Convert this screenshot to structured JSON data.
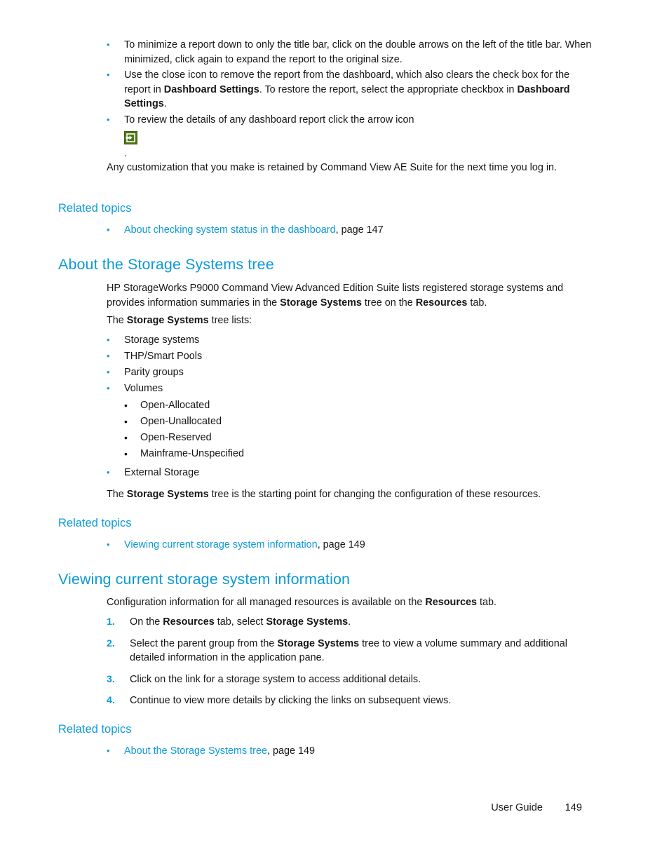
{
  "colors": {
    "heading_blue": "#0c9ad8",
    "link_blue": "#0c9ad8",
    "body_text": "#161616",
    "icon_green": "#4e7615",
    "page_background": "#ffffff"
  },
  "top_bullets": [
    {
      "bullet": "•",
      "text": "To minimize a report down to only the title bar, click on the double arrows on the left of the title bar. When minimized, click again to expand the report to the original size."
    },
    {
      "bullet": "•",
      "text_part_1": "Use the close icon to remove the report from the dashboard, which also clears the check box for the report in ",
      "bold_1": "Dashboard Settings",
      "text_part_2": ". To restore the report, select the appropriate checkbox in ",
      "bold_2": "Dashboard Settings",
      "text_part_3": "."
    },
    {
      "bullet": "•",
      "text": "To review the details of any dashboard report click the arrow icon",
      "icon_name": "open-details-arrow-icon",
      "trailing_period": "."
    }
  ],
  "customization_note": "Any customization that you make is retained by Command View AE Suite for the next time you log in.",
  "related_topics_1": {
    "heading": "Related topics",
    "items": [
      {
        "bullet": "•",
        "link": "About checking system status in the dashboard",
        "suffix": ", page 147"
      }
    ]
  },
  "section_storage_tree": {
    "heading": "About the Storage Systems tree",
    "intro_part_1": "HP StorageWorks P9000 Command View Advanced Edition Suite lists registered storage systems and provides information summaries in the ",
    "intro_bold_1": "Storage Systems",
    "intro_part_2": " tree on the ",
    "intro_bold_2": "Resources",
    "intro_part_3": " tab.",
    "lists_lead_part_1": "The ",
    "lists_lead_bold": "Storage Systems",
    "lists_lead_part_2": " tree lists:",
    "tree_items": [
      {
        "bullet": "•",
        "label": "Storage systems"
      },
      {
        "bullet": "•",
        "label": "THP/Smart Pools"
      },
      {
        "bullet": "•",
        "label": "Parity groups"
      },
      {
        "bullet": "•",
        "label": "Volumes"
      }
    ],
    "volume_sub_items": [
      {
        "bullet": "•",
        "label": "Open-Allocated"
      },
      {
        "bullet": "•",
        "label": "Open-Unallocated"
      },
      {
        "bullet": "•",
        "label": "Open-Reserved"
      },
      {
        "bullet": "•",
        "label": "Mainframe-Unspecified"
      }
    ],
    "external_storage": {
      "bullet": "•",
      "label": "External Storage"
    },
    "closing_part_1": "The ",
    "closing_bold": "Storage Systems",
    "closing_part_2": " tree is the starting point for changing the configuration of these resources."
  },
  "related_topics_2": {
    "heading": "Related topics",
    "items": [
      {
        "bullet": "•",
        "link": "Viewing current storage system information",
        "suffix": ", page 149"
      }
    ]
  },
  "section_viewing": {
    "heading": "Viewing current storage system information",
    "intro_part_1": "Configuration information for all managed resources is available on the ",
    "intro_bold": "Resources",
    "intro_part_2": " tab.",
    "steps": [
      {
        "number": "1.",
        "part_1": "On the ",
        "bold_1": "Resources",
        "part_2": " tab, select ",
        "bold_2": "Storage Systems",
        "part_3": "."
      },
      {
        "number": "2.",
        "part_1": "Select the parent group from the ",
        "bold_1": "Storage Systems",
        "part_2": " tree to view a volume summary and additional detailed information in the application pane.",
        "bold_2": "",
        "part_3": ""
      },
      {
        "number": "3.",
        "part_1": "Click on the link for a storage system to access additional details.",
        "bold_1": "",
        "part_2": "",
        "bold_2": "",
        "part_3": ""
      },
      {
        "number": "4.",
        "part_1": "Continue to view more details by clicking the links on subsequent views.",
        "bold_1": "",
        "part_2": "",
        "bold_2": "",
        "part_3": ""
      }
    ]
  },
  "related_topics_3": {
    "heading": "Related topics",
    "items": [
      {
        "bullet": "•",
        "link": "About the Storage Systems tree",
        "suffix": ", page 149"
      }
    ]
  },
  "footer": {
    "label": "User Guide",
    "page_number": "149"
  }
}
